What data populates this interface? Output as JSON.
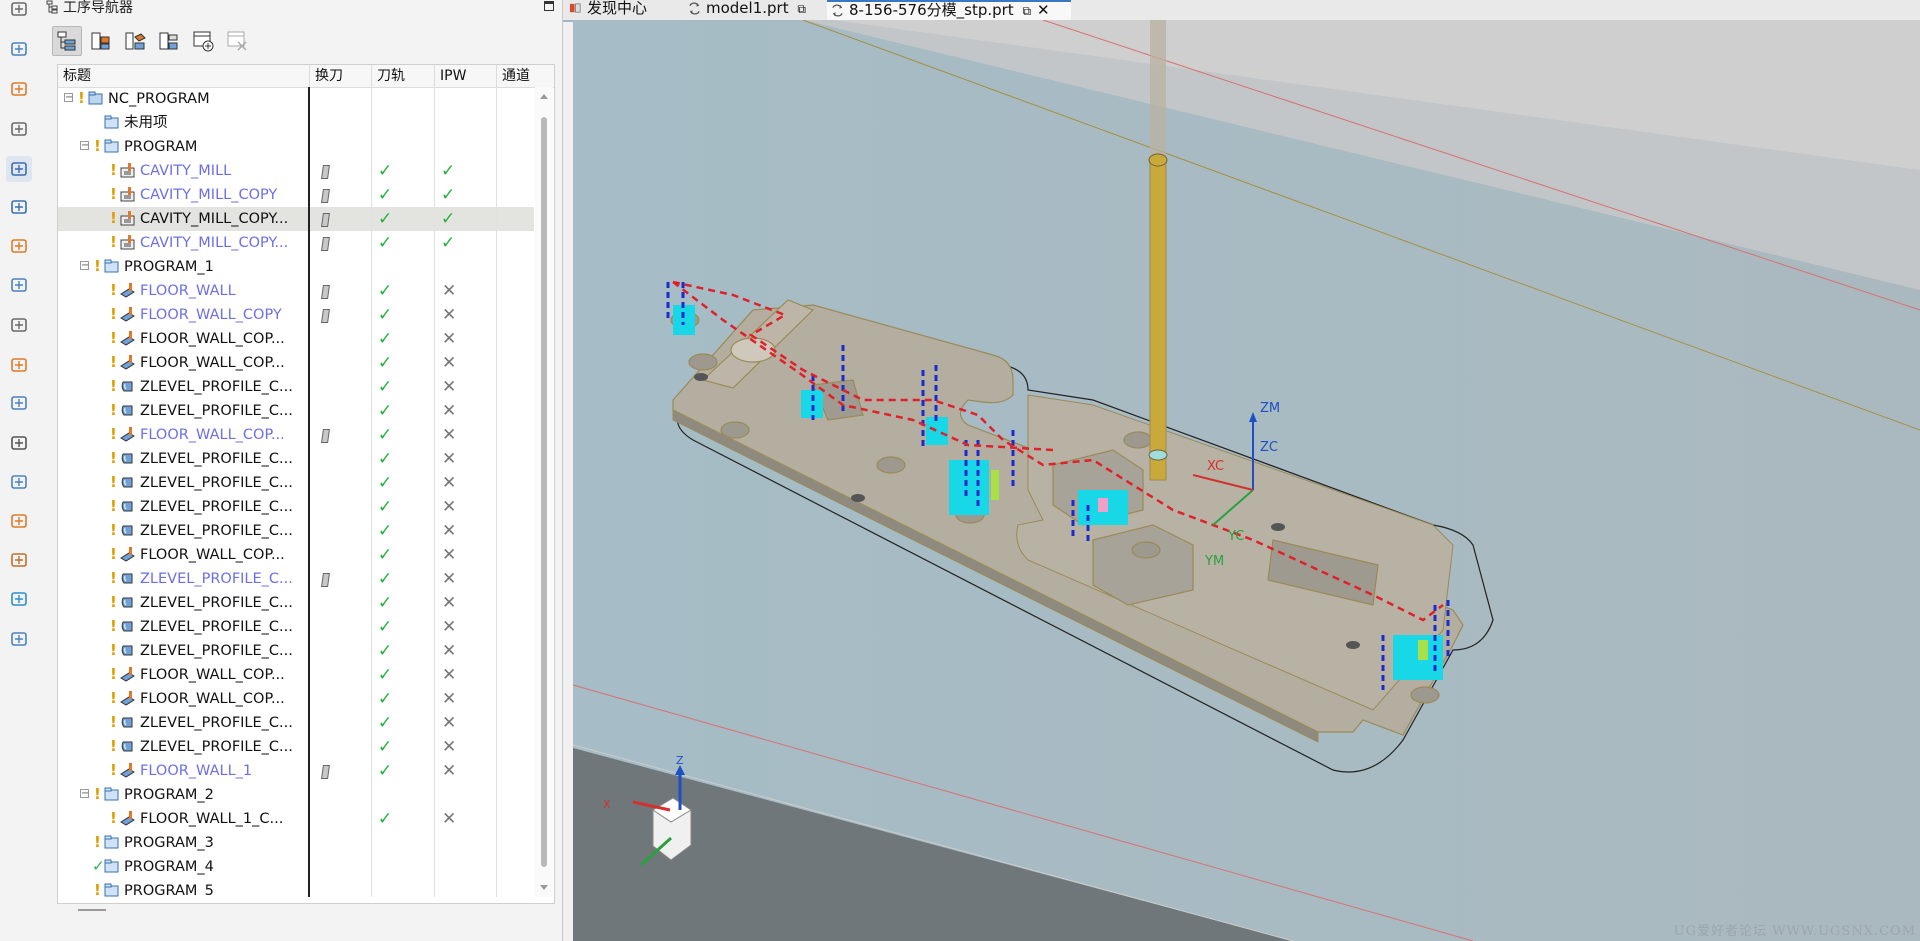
{
  "navigator": {
    "title": "工序导航器",
    "columns": [
      "标题",
      "换刀",
      "刀轨",
      "IPW",
      "通道"
    ],
    "rows": [
      {
        "level": 0,
        "twist": "minus",
        "status": "warn",
        "icon": "program-root-icon",
        "label": "NC_PROGRAM",
        "blue": false,
        "tool": false,
        "path": "",
        "ipw": ""
      },
      {
        "level": 1,
        "twist": "",
        "status": "",
        "icon": "program-group-icon",
        "label": "未用项",
        "blue": false,
        "tool": false,
        "path": "",
        "ipw": ""
      },
      {
        "level": 1,
        "twist": "minus",
        "status": "warn",
        "icon": "program-group-icon",
        "label": "PROGRAM",
        "blue": false,
        "tool": false,
        "path": "",
        "ipw": ""
      },
      {
        "level": 2,
        "twist": "",
        "status": "warn",
        "icon": "cavity-mill-icon",
        "label": "CAVITY_MILL",
        "blue": true,
        "tool": true,
        "path": "check",
        "ipw": "check"
      },
      {
        "level": 2,
        "twist": "",
        "status": "warn",
        "icon": "cavity-mill-icon",
        "label": "CAVITY_MILL_COPY",
        "blue": true,
        "tool": true,
        "path": "check",
        "ipw": "check"
      },
      {
        "level": 2,
        "twist": "",
        "status": "warn",
        "icon": "cavity-mill-icon",
        "label": "CAVITY_MILL_COPY...",
        "blue": false,
        "tool": true,
        "path": "check",
        "ipw": "check",
        "highlight": true
      },
      {
        "level": 2,
        "twist": "",
        "status": "warn",
        "icon": "cavity-mill-icon",
        "label": "CAVITY_MILL_COPY...",
        "blue": true,
        "tool": true,
        "path": "check",
        "ipw": "check"
      },
      {
        "level": 1,
        "twist": "minus",
        "status": "warn",
        "icon": "program-group-icon",
        "label": "PROGRAM_1",
        "blue": false,
        "tool": false,
        "path": "",
        "ipw": ""
      },
      {
        "level": 2,
        "twist": "",
        "status": "warn",
        "icon": "floor-wall-icon",
        "label": "FLOOR_WALL",
        "blue": true,
        "tool": true,
        "path": "check",
        "ipw": "cross"
      },
      {
        "level": 2,
        "twist": "",
        "status": "warn",
        "icon": "floor-wall-icon",
        "label": "FLOOR_WALL_COPY",
        "blue": true,
        "tool": true,
        "path": "check",
        "ipw": "cross"
      },
      {
        "level": 2,
        "twist": "",
        "status": "warn",
        "icon": "floor-wall-icon",
        "label": "FLOOR_WALL_COP...",
        "blue": false,
        "tool": false,
        "path": "check",
        "ipw": "cross"
      },
      {
        "level": 2,
        "twist": "",
        "status": "warn",
        "icon": "floor-wall-icon",
        "label": "FLOOR_WALL_COP...",
        "blue": false,
        "tool": false,
        "path": "check",
        "ipw": "cross"
      },
      {
        "level": 2,
        "twist": "",
        "status": "warn",
        "icon": "zlevel-profile-icon",
        "label": "ZLEVEL_PROFILE_C...",
        "blue": false,
        "tool": false,
        "path": "check",
        "ipw": "cross"
      },
      {
        "level": 2,
        "twist": "",
        "status": "warn",
        "icon": "zlevel-profile-icon",
        "label": "ZLEVEL_PROFILE_C...",
        "blue": false,
        "tool": false,
        "path": "check",
        "ipw": "cross"
      },
      {
        "level": 2,
        "twist": "",
        "status": "warn",
        "icon": "floor-wall-icon",
        "label": "FLOOR_WALL_COP...",
        "blue": true,
        "tool": true,
        "path": "check",
        "ipw": "cross"
      },
      {
        "level": 2,
        "twist": "",
        "status": "warn",
        "icon": "zlevel-profile-icon",
        "label": "ZLEVEL_PROFILE_C...",
        "blue": false,
        "tool": false,
        "path": "check",
        "ipw": "cross"
      },
      {
        "level": 2,
        "twist": "",
        "status": "warn",
        "icon": "zlevel-profile-icon",
        "label": "ZLEVEL_PROFILE_C...",
        "blue": false,
        "tool": false,
        "path": "check",
        "ipw": "cross"
      },
      {
        "level": 2,
        "twist": "",
        "status": "warn",
        "icon": "zlevel-profile-icon",
        "label": "ZLEVEL_PROFILE_C...",
        "blue": false,
        "tool": false,
        "path": "check",
        "ipw": "cross"
      },
      {
        "level": 2,
        "twist": "",
        "status": "warn",
        "icon": "zlevel-profile-icon",
        "label": "ZLEVEL_PROFILE_C...",
        "blue": false,
        "tool": false,
        "path": "check",
        "ipw": "cross"
      },
      {
        "level": 2,
        "twist": "",
        "status": "warn",
        "icon": "floor-wall-icon",
        "label": "FLOOR_WALL_COP...",
        "blue": false,
        "tool": false,
        "path": "check",
        "ipw": "cross"
      },
      {
        "level": 2,
        "twist": "",
        "status": "warn",
        "icon": "zlevel-profile-icon",
        "label": "ZLEVEL_PROFILE_C...",
        "blue": true,
        "tool": true,
        "path": "check",
        "ipw": "cross"
      },
      {
        "level": 2,
        "twist": "",
        "status": "warn",
        "icon": "zlevel-profile-icon",
        "label": "ZLEVEL_PROFILE_C...",
        "blue": false,
        "tool": false,
        "path": "check",
        "ipw": "cross"
      },
      {
        "level": 2,
        "twist": "",
        "status": "warn",
        "icon": "zlevel-profile-icon",
        "label": "ZLEVEL_PROFILE_C...",
        "blue": false,
        "tool": false,
        "path": "check",
        "ipw": "cross"
      },
      {
        "level": 2,
        "twist": "",
        "status": "warn",
        "icon": "zlevel-profile-icon",
        "label": "ZLEVEL_PROFILE_C...",
        "blue": false,
        "tool": false,
        "path": "check",
        "ipw": "cross"
      },
      {
        "level": 2,
        "twist": "",
        "status": "warn",
        "icon": "floor-wall-icon",
        "label": "FLOOR_WALL_COP...",
        "blue": false,
        "tool": false,
        "path": "check",
        "ipw": "cross"
      },
      {
        "level": 2,
        "twist": "",
        "status": "warn",
        "icon": "floor-wall-icon",
        "label": "FLOOR_WALL_COP...",
        "blue": false,
        "tool": false,
        "path": "check",
        "ipw": "cross"
      },
      {
        "level": 2,
        "twist": "",
        "status": "warn",
        "icon": "zlevel-profile-icon",
        "label": "ZLEVEL_PROFILE_C...",
        "blue": false,
        "tool": false,
        "path": "check",
        "ipw": "cross"
      },
      {
        "level": 2,
        "twist": "",
        "status": "warn",
        "icon": "zlevel-profile-icon",
        "label": "ZLEVEL_PROFILE_C...",
        "blue": false,
        "tool": false,
        "path": "check",
        "ipw": "cross"
      },
      {
        "level": 2,
        "twist": "",
        "status": "warn",
        "icon": "floor-wall-icon",
        "label": "FLOOR_WALL_1",
        "blue": true,
        "tool": true,
        "path": "check",
        "ipw": "cross"
      },
      {
        "level": 1,
        "twist": "minus",
        "status": "warn",
        "icon": "program-group-icon",
        "label": "PROGRAM_2",
        "blue": false,
        "tool": false,
        "path": "",
        "ipw": ""
      },
      {
        "level": 2,
        "twist": "",
        "status": "warn",
        "icon": "floor-wall-icon",
        "label": "FLOOR_WALL_1_C...",
        "blue": false,
        "tool": false,
        "path": "check",
        "ipw": "cross"
      },
      {
        "level": 1,
        "twist": "",
        "status": "warn",
        "icon": "program-group-icon",
        "label": "PROGRAM_3",
        "blue": false,
        "tool": false,
        "path": "",
        "ipw": ""
      },
      {
        "level": 1,
        "twist": "",
        "status": "ok",
        "icon": "program-group-icon",
        "label": "PROGRAM_4",
        "blue": false,
        "tool": false,
        "path": "",
        "ipw": ""
      },
      {
        "level": 1,
        "twist": "",
        "status": "warn",
        "icon": "program-group-icon",
        "label": "PROGRAM_5",
        "blue": false,
        "tool": false,
        "path": "",
        "ipw": ""
      }
    ]
  },
  "tabs": [
    {
      "label": "发现中心",
      "icon": "discovery-icon",
      "active": false,
      "closable": false
    },
    {
      "label": "model1.prt",
      "icon": "part-file-icon",
      "active": false,
      "closable": false
    },
    {
      "label": "8-156-576分模_stp.prt",
      "icon": "part-file-icon",
      "active": true,
      "closable": true
    }
  ],
  "viewport": {
    "axis_labels": {
      "zm": "ZM",
      "zc": "ZC",
      "xc": "XC",
      "yc": "YC",
      "ym": "YM",
      "triad_z": "Z",
      "triad_x": "X"
    },
    "watermark": "UG爱好者论坛 WWW.UGSNX.COM"
  },
  "colors": {
    "blue_label": "#6e6ee8",
    "check": "#26b13d",
    "warn": "#e0a000",
    "toolpath": "#e0202a",
    "tool_shank": "#c9a93a"
  }
}
